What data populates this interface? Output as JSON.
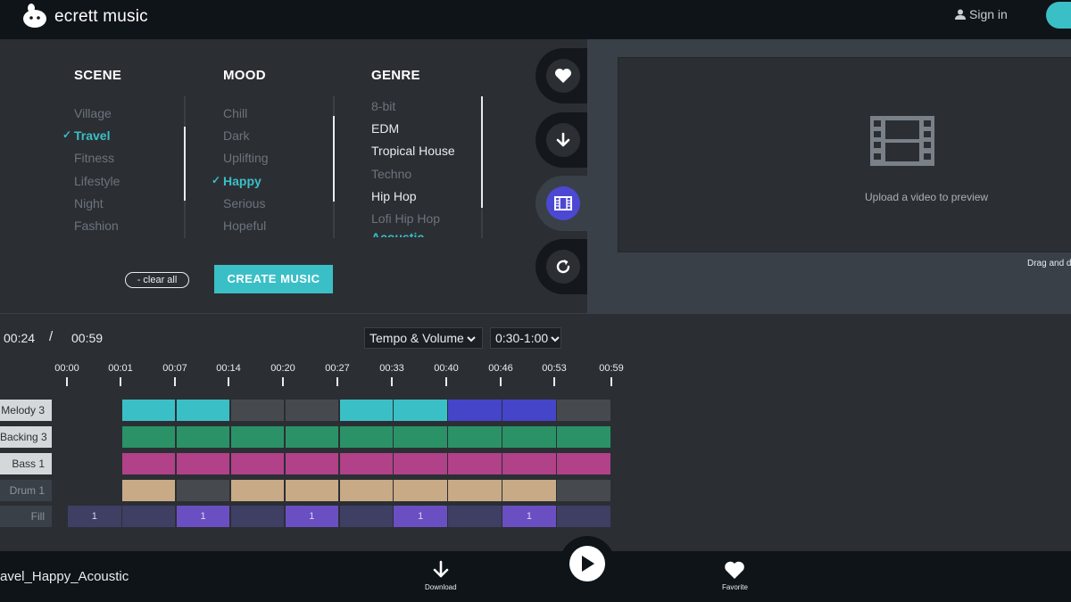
{
  "header": {
    "app_name": "ecrett music",
    "sign_in_label": "Sign in"
  },
  "selector": {
    "scene": {
      "title": "SCENE",
      "options": [
        "Village",
        "Travel",
        "Fitness",
        "Lifestyle",
        "Night",
        "Fashion"
      ],
      "selected": "Travel"
    },
    "mood": {
      "title": "MOOD",
      "options": [
        "Chill",
        "Dark",
        "Uplifting",
        "Happy",
        "Serious",
        "Hopeful"
      ],
      "selected": "Happy"
    },
    "genre": {
      "title": "GENRE",
      "options": [
        "8-bit",
        "EDM",
        "Tropical House",
        "Techno",
        "Hip Hop",
        "Lofi Hip Hop",
        "Acoustic"
      ],
      "selected": "Acoustic"
    },
    "clear_all_label": "- clear all",
    "create_label": "CREATE MUSIC"
  },
  "side_icons": [
    "heart-icon",
    "download-icon",
    "film-icon",
    "refresh-icon"
  ],
  "preview": {
    "upload_text": "Upload a video to preview",
    "drag_text": "Drag and d"
  },
  "timeline": {
    "current_time": "00:24",
    "separator": "/",
    "total_time": "00:59",
    "mode_select": "Tempo & Volume",
    "range_select": "0:30-1:00",
    "ticks": [
      "00:00",
      "00:01",
      "00:07",
      "00:14",
      "00:20",
      "00:27",
      "00:33",
      "00:40",
      "00:46",
      "00:53",
      "00:59"
    ],
    "tracks": [
      {
        "label": "Melody 3",
        "style": "light",
        "cells": [
          "empty",
          "teal",
          "teal",
          "gray",
          "gray",
          "teal",
          "teal",
          "blue",
          "blue",
          "gray"
        ]
      },
      {
        "label": "Backing 3",
        "style": "light",
        "cells": [
          "empty",
          "green",
          "green",
          "green",
          "green",
          "green",
          "green",
          "green",
          "green",
          "green"
        ]
      },
      {
        "label": "Bass 1",
        "style": "light",
        "cells": [
          "empty",
          "magenta",
          "magenta",
          "magenta",
          "magenta",
          "magenta",
          "magenta",
          "magenta",
          "magenta",
          "magenta"
        ]
      },
      {
        "label": "Drum 1",
        "style": "dark",
        "cells": [
          "empty",
          "tan",
          "gray",
          "tan",
          "tan",
          "tan",
          "tan",
          "tan",
          "tan",
          "gray"
        ]
      },
      {
        "label": "Fill",
        "style": "dark",
        "cells": [
          "fill-dim",
          "fill-dim",
          "fill-on",
          "fill-dim",
          "fill-on",
          "fill-dim",
          "fill-on",
          "fill-dim",
          "fill-on",
          "fill-dim"
        ],
        "numbers": [
          "1",
          "",
          "1",
          "",
          "1",
          "",
          "1",
          "",
          "1",
          ""
        ]
      }
    ],
    "colors": {
      "teal": "#3bbfc6",
      "blue": "#4445c9",
      "gray": "#464a4f",
      "green": "#2b9267",
      "magenta": "#b14189",
      "tan": "#c8aa86",
      "fill-dim": "#3e3f63",
      "fill-on": "#6a4fc2",
      "empty": "transparent"
    }
  },
  "bottom_bar": {
    "track_name": "avel_Happy_Acoustic",
    "download_label": "Download",
    "favorite_label": "Favorite"
  }
}
